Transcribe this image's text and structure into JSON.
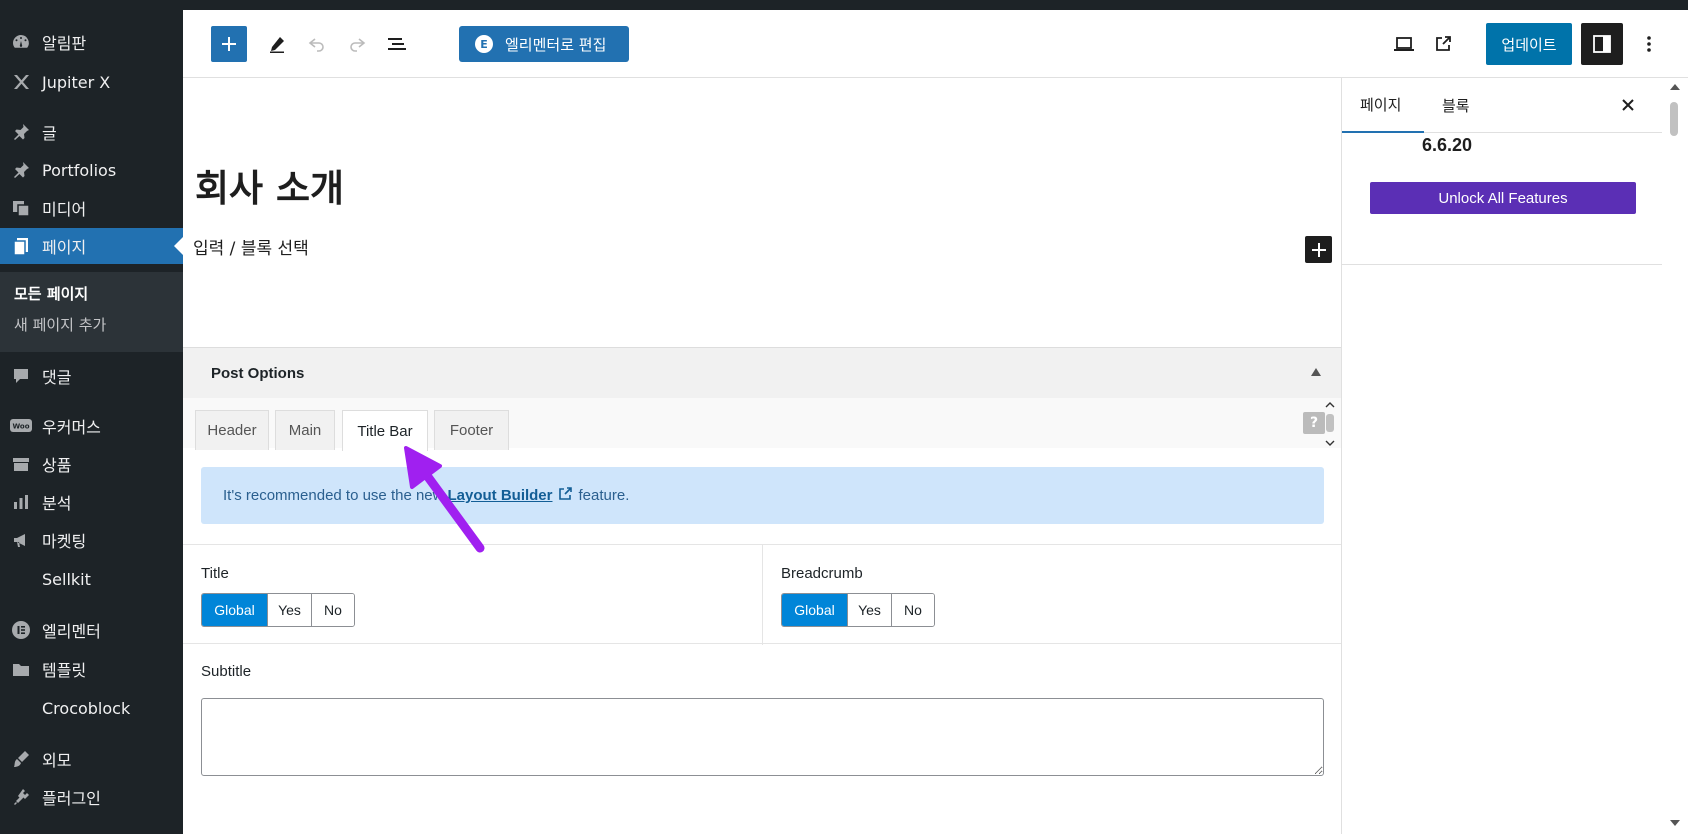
{
  "sidebar": {
    "items": [
      {
        "label": "알림판",
        "icon": "dashboard-icon"
      },
      {
        "label": "Jupiter X",
        "icon": "jupiter-x-icon"
      },
      {
        "label": "글",
        "icon": "pin-icon"
      },
      {
        "label": "Portfolios",
        "icon": "pin-icon"
      },
      {
        "label": "미디어",
        "icon": "media-icon"
      },
      {
        "label": "페이지",
        "icon": "pages-icon"
      },
      {
        "label": "댓글",
        "icon": "comment-icon"
      },
      {
        "label": "우커머스",
        "icon": "woo-icon"
      },
      {
        "label": "상품",
        "icon": "archive-icon"
      },
      {
        "label": "분석",
        "icon": "chart-bar-icon"
      },
      {
        "label": "마켓팅",
        "icon": "megaphone-icon"
      },
      {
        "label": "Sellkit",
        "icon": "sellkit-icon"
      },
      {
        "label": "엘리멘터",
        "icon": "elementor-icon"
      },
      {
        "label": "템플릿",
        "icon": "folder-icon"
      },
      {
        "label": "Crocoblock",
        "icon": "crocoblock-icon"
      },
      {
        "label": "외모",
        "icon": "brush-icon"
      },
      {
        "label": "플러그인",
        "icon": "plugin-icon"
      }
    ],
    "submenu": {
      "current": "모든 페이지",
      "add_new": "새 페이지 추가"
    }
  },
  "toolbar": {
    "elementor_label": "엘리멘터로 편집",
    "update_label": "업데이트"
  },
  "editor": {
    "page_title": "회사 소개",
    "placeholder": "입력 / 블록 선택"
  },
  "post_options": {
    "title": "Post Options",
    "tabs": [
      "Header",
      "Main",
      "Title Bar",
      "Footer"
    ],
    "active_tab": "Title Bar",
    "help": "?",
    "notice": {
      "prefix": "It's recommended to use the new",
      "link": "Layout Builder",
      "suffix": "feature."
    },
    "title_field": {
      "label": "Title",
      "options": [
        "Global",
        "Yes",
        "No"
      ],
      "selected": "Global"
    },
    "breadcrumb_field": {
      "label": "Breadcrumb",
      "options": [
        "Global",
        "Yes",
        "No"
      ],
      "selected": "Global"
    },
    "subtitle_field": {
      "label": "Subtitle",
      "value": ""
    }
  },
  "inspector": {
    "tabs": [
      "페이지",
      "블록"
    ],
    "active_tab": "페이지",
    "version": "6.6.20",
    "unlock_label": "Unlock All Features"
  },
  "colors": {
    "admin_bg": "#1d2327",
    "wp_blue": "#2271b1",
    "toggle_on": "#0085d8",
    "unlock_purple": "#5b2fb5",
    "notice_bg": "#cfe5fb",
    "annotation_arrow": "#a020f0"
  }
}
